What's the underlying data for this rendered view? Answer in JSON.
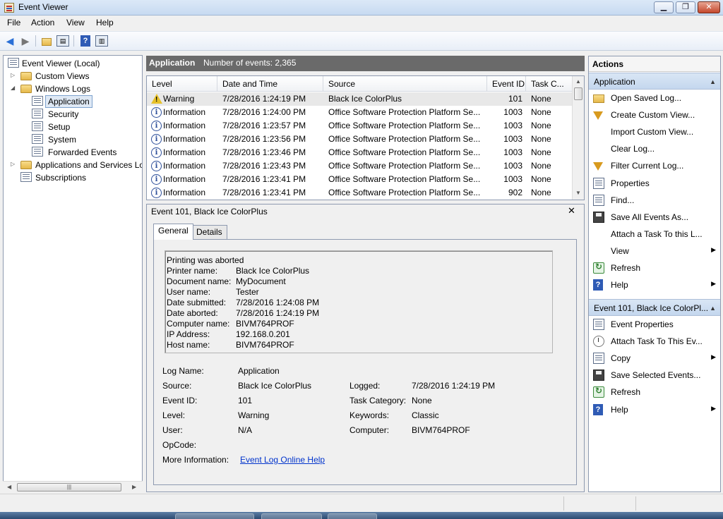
{
  "window": {
    "title": "Event Viewer"
  },
  "menu": {
    "file": "File",
    "action": "Action",
    "view": "View",
    "help": "Help"
  },
  "toolbar": {
    "help_glyph": "?"
  },
  "tree": {
    "root": "Event Viewer (Local)",
    "custom_views": "Custom Views",
    "windows_logs": "Windows Logs",
    "application": "Application",
    "security": "Security",
    "setup": "Setup",
    "system": "System",
    "forwarded_events": "Forwarded Events",
    "apps_services": "Applications and Services Lo",
    "subscriptions": "Subscriptions"
  },
  "center": {
    "title": "Application",
    "count": "Number of events: 2,365"
  },
  "grid": {
    "headers": {
      "level": "Level",
      "date": "Date and Time",
      "source": "Source",
      "event_id": "Event ID",
      "task": "Task C..."
    },
    "rows": [
      {
        "level": "Warning",
        "date": "7/28/2016 1:24:19 PM",
        "source": "Black Ice ColorPlus",
        "event_id": "101",
        "task": "None"
      },
      {
        "level": "Information",
        "date": "7/28/2016 1:24:00 PM",
        "source": "Office Software Protection Platform Se...",
        "event_id": "1003",
        "task": "None"
      },
      {
        "level": "Information",
        "date": "7/28/2016 1:23:57 PM",
        "source": "Office Software Protection Platform Se...",
        "event_id": "1003",
        "task": "None"
      },
      {
        "level": "Information",
        "date": "7/28/2016 1:23:56 PM",
        "source": "Office Software Protection Platform Se...",
        "event_id": "1003",
        "task": "None"
      },
      {
        "level": "Information",
        "date": "7/28/2016 1:23:46 PM",
        "source": "Office Software Protection Platform Se...",
        "event_id": "1003",
        "task": "None"
      },
      {
        "level": "Information",
        "date": "7/28/2016 1:23:43 PM",
        "source": "Office Software Protection Platform Se...",
        "event_id": "1003",
        "task": "None"
      },
      {
        "level": "Information",
        "date": "7/28/2016 1:23:41 PM",
        "source": "Office Software Protection Platform Se...",
        "event_id": "1003",
        "task": "None"
      },
      {
        "level": "Information",
        "date": "7/28/2016 1:23:41 PM",
        "source": "Office Software Protection Platform Se...",
        "event_id": "902",
        "task": "None"
      }
    ]
  },
  "detail": {
    "title": "Event 101, Black Ice ColorPlus",
    "close": "✕",
    "tabs": {
      "general": "General",
      "details": "Details"
    },
    "description": {
      "first_line": "Printing was aborted",
      "lines": [
        {
          "label": "Printer name:",
          "value": "Black Ice ColorPlus"
        },
        {
          "label": "Document name:",
          "value": "MyDocument"
        },
        {
          "label": "User name:",
          "value": "Tester"
        },
        {
          "label": "Date submitted:",
          "value": "7/28/2016 1:24:08 PM"
        },
        {
          "label": "Date aborted:",
          "value": "7/28/2016 1:24:19 PM"
        },
        {
          "label": "Computer name:",
          "value": "BIVM764PROF"
        },
        {
          "label": "IP Address:",
          "value": "192.168.0.201"
        },
        {
          "label": "Host name:",
          "value": "BIVM764PROF"
        }
      ]
    },
    "fields": {
      "log_name_label": "Log Name:",
      "log_name": "Application",
      "source_label": "Source:",
      "source": "Black Ice ColorPlus",
      "logged_label": "Logged:",
      "logged": "7/28/2016 1:24:19 PM",
      "event_id_label": "Event ID:",
      "event_id": "101",
      "task_category_label": "Task Category:",
      "task_category": "None",
      "level_label": "Level:",
      "level": "Warning",
      "keywords_label": "Keywords:",
      "keywords": "Classic",
      "user_label": "User:",
      "user": "N/A",
      "computer_label": "Computer:",
      "computer": "BIVM764PROF",
      "opcode_label": "OpCode:",
      "more_info_label": "More Information:",
      "more_info_link": "Event Log Online Help"
    }
  },
  "actions": {
    "title": "Actions",
    "section1": "Application",
    "items1": [
      {
        "label": "Open Saved Log...",
        "icon": "folder-icon"
      },
      {
        "label": "Create Custom View...",
        "icon": "filter-icon"
      },
      {
        "label": "Import Custom View...",
        "icon": "none"
      },
      {
        "label": "Clear Log...",
        "icon": "none"
      },
      {
        "label": "Filter Current Log...",
        "icon": "filter-icon"
      },
      {
        "label": "Properties",
        "icon": "properties-icon"
      },
      {
        "label": "Find...",
        "icon": "find-icon"
      },
      {
        "label": "Save All Events As...",
        "icon": "save-icon"
      },
      {
        "label": "Attach a Task To this L...",
        "icon": "none"
      },
      {
        "label": "View",
        "icon": "none"
      },
      {
        "label": "Refresh",
        "icon": "refresh-icon"
      },
      {
        "label": "Help",
        "icon": "help-icon"
      }
    ],
    "section2": "Event 101, Black Ice ColorPl...",
    "items2": [
      {
        "label": "Event Properties",
        "icon": "properties-icon"
      },
      {
        "label": "Attach Task To This Ev...",
        "icon": "task-icon"
      },
      {
        "label": "Copy",
        "icon": "copy-icon"
      },
      {
        "label": "Save Selected Events...",
        "icon": "save-icon"
      },
      {
        "label": "Refresh",
        "icon": "refresh-icon"
      },
      {
        "label": "Help",
        "icon": "help-icon"
      }
    ]
  },
  "colors": {
    "header_bg": "#6a6a6a",
    "section_bg": "#c4d7ee",
    "link": "#0033cc"
  }
}
